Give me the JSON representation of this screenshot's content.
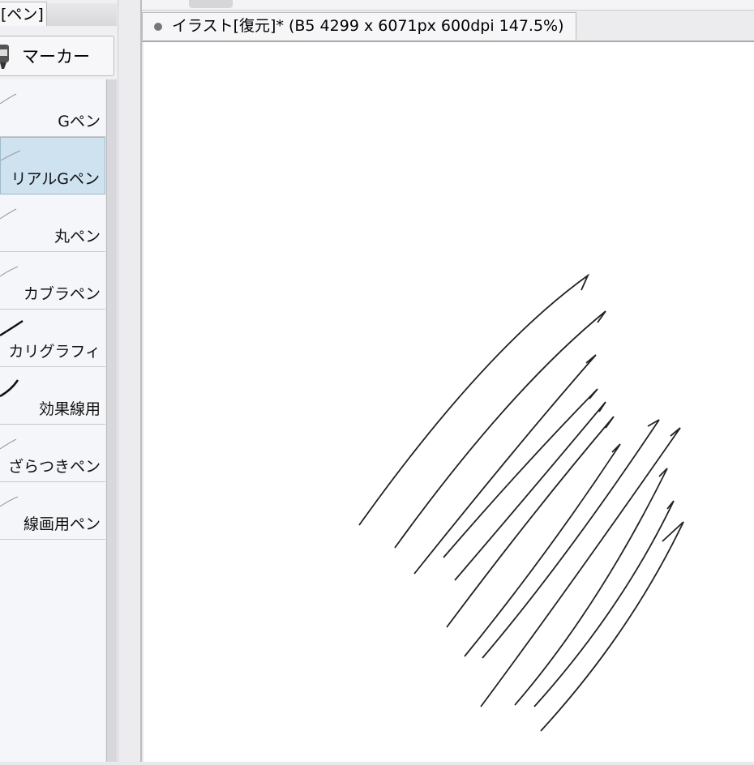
{
  "tool_panel": {
    "subtool_tab": "[ペン]",
    "group_button": "マーカー",
    "brushes": [
      {
        "label": "Gペン",
        "selected": false
      },
      {
        "label": "リアルGペン",
        "selected": true
      },
      {
        "label": "丸ペン",
        "selected": false
      },
      {
        "label": "カブラペン",
        "selected": false
      },
      {
        "label": "カリグラフィ",
        "selected": false
      },
      {
        "label": "効果線用",
        "selected": false
      },
      {
        "label": "ざらつきペン",
        "selected": false
      },
      {
        "label": "線画用ペン",
        "selected": false
      }
    ]
  },
  "document": {
    "tab_title": "イラスト[復元]* (B5 4299 x 6071px 600dpi 147.5%)"
  },
  "colors": {
    "selected_item": "#cfe2f0",
    "stroke": "#222222"
  }
}
